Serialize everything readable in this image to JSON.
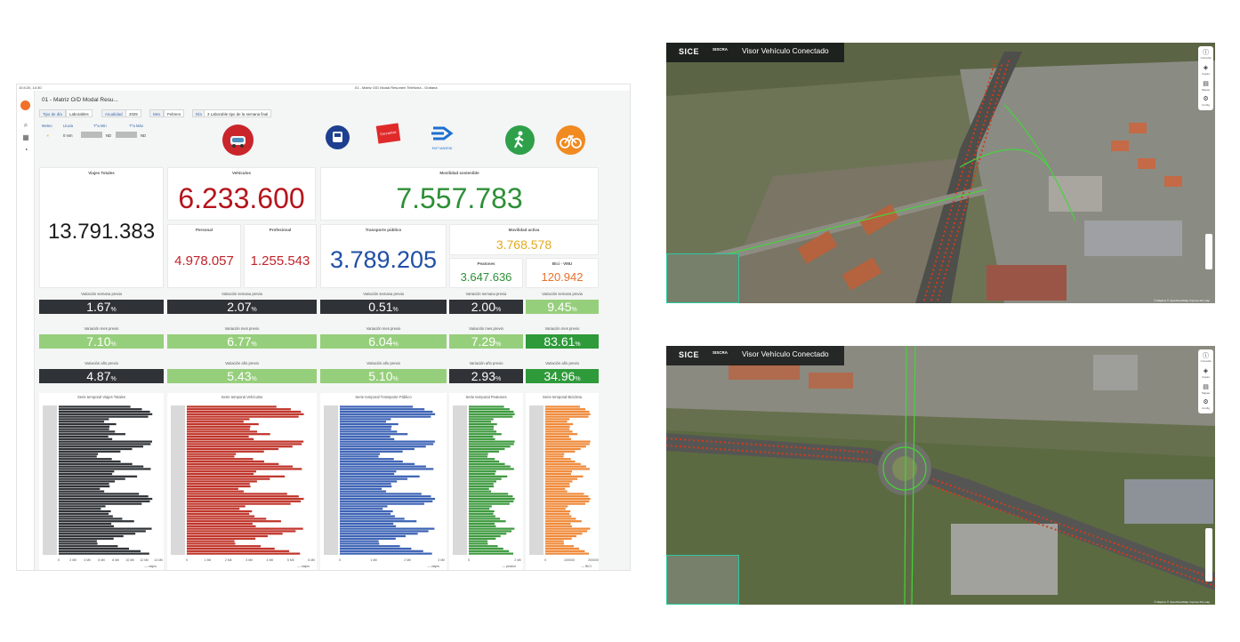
{
  "window": {
    "clock": "10:4:20, 14:30",
    "title": "01 - Matriz O/D Modal Resumen Telefonía - Grafana"
  },
  "dashboard": {
    "title": "01 - Matriz O/D Modal Resu...",
    "filters": [
      {
        "label": "Tipo de día",
        "value": "Laborables"
      },
      {
        "label": "Anualidad",
        "value": "2025"
      },
      {
        "label": "Mes",
        "value": "Febrero"
      },
      {
        "label": "Día",
        "value": "3 Laborable tipo de la semana final"
      }
    ],
    "meteo": {
      "headers": [
        "Meteo",
        "Lluvia",
        "T^a Min",
        "T^a Máx"
      ],
      "values": [
        "☀",
        "0 mm",
        "ND",
        "ND"
      ]
    },
    "icons": [
      {
        "name": "car-icon",
        "color": "#c9252b"
      },
      {
        "name": "metro-icon",
        "color": "#1d3f8f"
      },
      {
        "name": "renfe-cercanias-logo",
        "label": "Cercanías"
      },
      {
        "name": "emt-madrid-logo",
        "label": "EMT MADRID"
      },
      {
        "name": "pedestrian-icon",
        "color": "#2ea04a"
      },
      {
        "name": "bicycle-icon",
        "color": "#f08a21"
      }
    ],
    "kpis": {
      "viajes_totales": {
        "title": "Viajes Totales",
        "value": "13.791.383"
      },
      "vehiculos": {
        "title": "Vehículos",
        "value": "6.233.600",
        "color": "#b5151c"
      },
      "personal": {
        "title": "Personal",
        "value": "4.978.057",
        "color": "#c1232a"
      },
      "profesional": {
        "title": "Profesional",
        "value": "1.255.543",
        "color": "#c1232a"
      },
      "movilidad_sostenible": {
        "title": "Movilidad sostenible",
        "value": "7.557.783",
        "color": "#2d8f37"
      },
      "transporte_publico": {
        "title": "Transporte público",
        "value": "3.789.205",
        "color": "#1f4fa6"
      },
      "movilidad_activa": {
        "title": "Movilidad activa",
        "value": "3.768.578",
        "color": "#e3a91c"
      },
      "peatones": {
        "title": "Peatones",
        "value": "3.647.636",
        "color": "#2d8f37"
      },
      "bici": {
        "title": "Bici - VMU",
        "value": "120.942",
        "color": "#e8702a"
      }
    },
    "stats_labels": {
      "semana": "Variación semana previa",
      "mes": "Variación mes previo",
      "anio": "Variación año previo"
    },
    "stats": [
      {
        "semana": "1.67",
        "mes": "7.10",
        "anio": "4.87"
      },
      {
        "semana": "2.07",
        "mes": "6.77",
        "anio": "5.43"
      },
      {
        "semana": "0.51",
        "mes": "6.04",
        "anio": "5.10"
      },
      {
        "semana": "2.00",
        "mes": "7.29",
        "anio": "2.93"
      },
      {
        "semana": "9.45",
        "mes": "83.61",
        "anio": "34.96"
      }
    ],
    "percent": "%",
    "charts": [
      {
        "title": "Serie temporal Viajes Totales",
        "color": "#2f3236",
        "legend": "viajes",
        "ticks": [
          "0",
          "2 Mil",
          "4 Mil",
          "6 Mil",
          "8 Mil",
          "10 Mil",
          "12 Mil",
          "14 Mil"
        ]
      },
      {
        "title": "Serie temporal Vehículos",
        "color": "#c0352b",
        "legend": "viajes",
        "ticks": [
          "0",
          "1 Mil",
          "2 Mil",
          "3 Mil",
          "4 Mil",
          "5 Mil",
          "6 Mil"
        ]
      },
      {
        "title": "Serie temporal Transporte Público",
        "color": "#3d63b5",
        "legend": "viajes",
        "ticks": [
          "0",
          "1 Mil",
          "2 Mil",
          "3 Mil"
        ]
      },
      {
        "title": "Serie temporal Peatones",
        "color": "#3e9a3f",
        "legend": "peatón",
        "ticks": [
          "0",
          "2 Mil"
        ]
      },
      {
        "title": "Serie temporal Bicicleta",
        "color": "#ef8a3a",
        "legend": "BICI",
        "ticks": [
          "0",
          "100000",
          "200000"
        ]
      }
    ]
  },
  "maps": [
    {
      "brand": "SICE",
      "sub": "SISCRA",
      "title": "Visor Vehículo Conectado",
      "attribution": "© Mapbox © OpenStreetMap Improve this map"
    },
    {
      "brand": "SICE",
      "sub": "SISCRA",
      "title": "Visor Vehículo Conectado",
      "attribution": "© Mapbox © OpenStreetMap Improve this map"
    }
  ],
  "map_toolbar": [
    "Consulta",
    "Capas",
    "Mapas",
    "Config"
  ]
}
